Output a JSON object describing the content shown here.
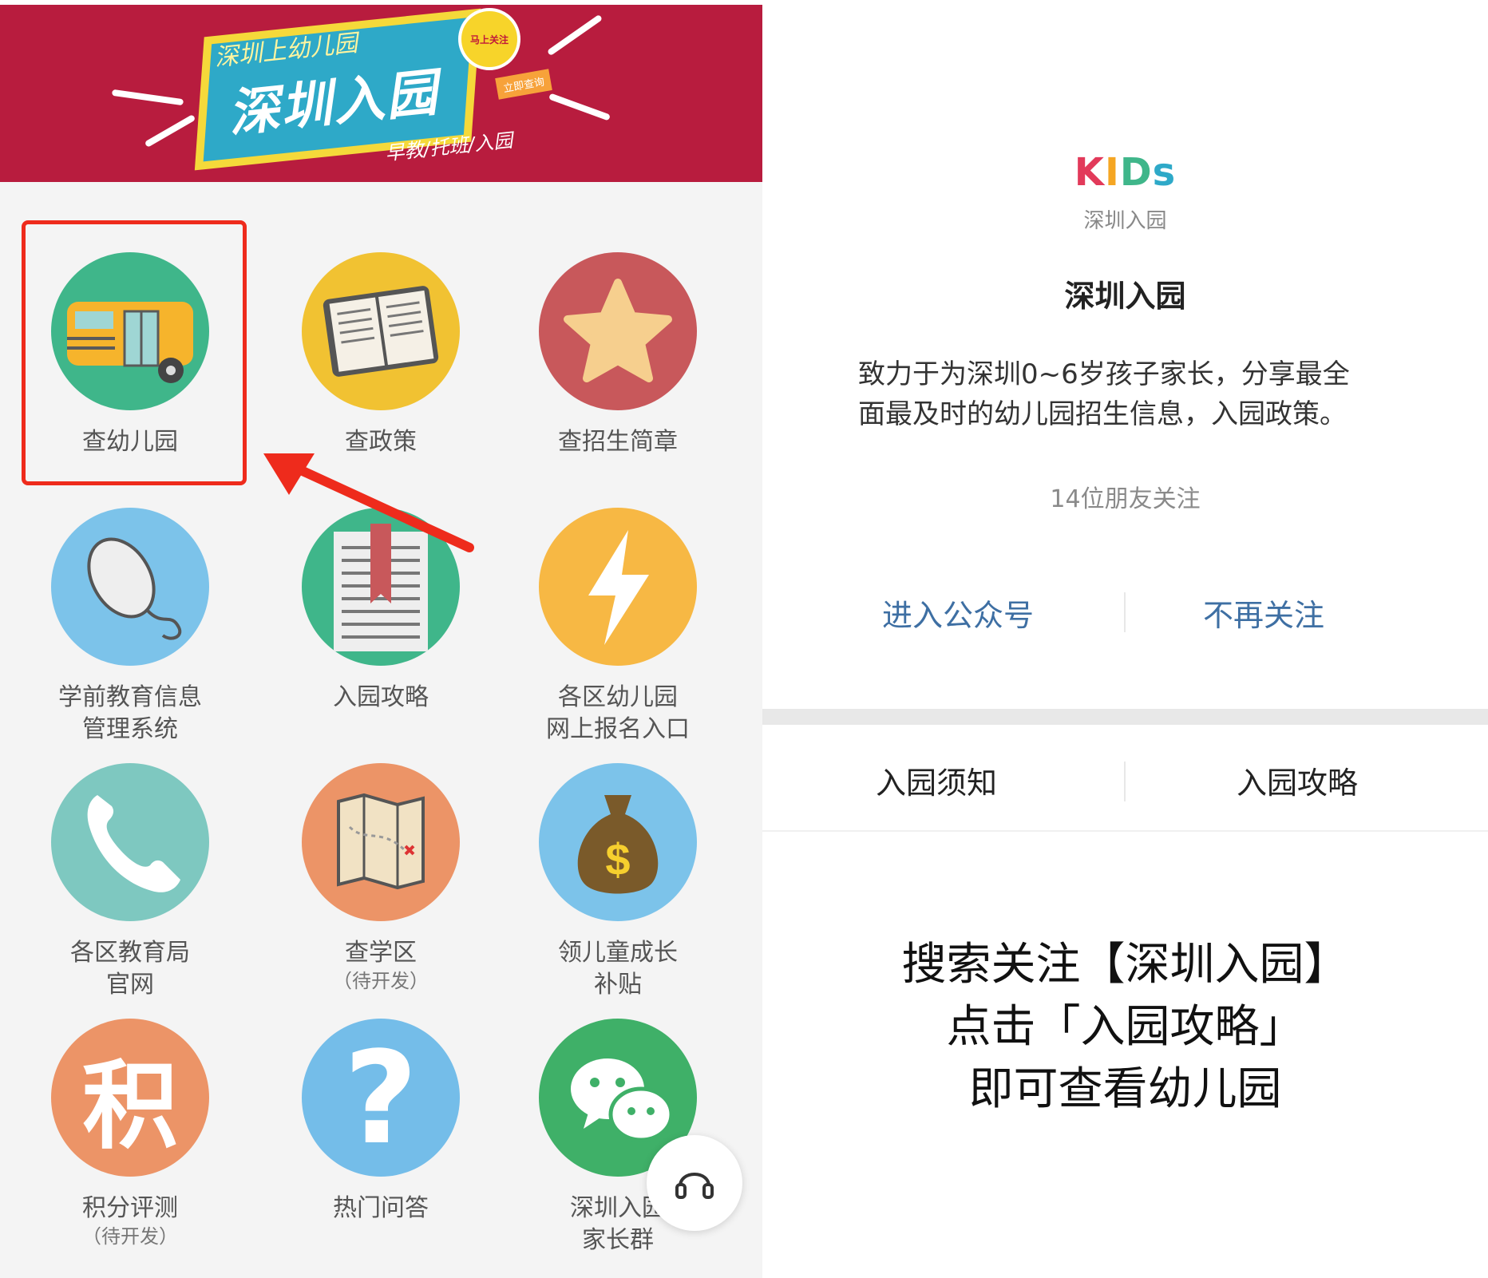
{
  "banner": {
    "line1": "深圳上幼儿园",
    "main_title": "深圳入园",
    "line3": "早教/托班/入园",
    "badge": "马上关注",
    "tag": "立即查询"
  },
  "grid": [
    {
      "label": "查幼儿园",
      "sub": "",
      "icon": "school-bus-icon",
      "color": "#3fb68a"
    },
    {
      "label": "查政策",
      "sub": "",
      "icon": "open-book-icon",
      "color": "#f1c232"
    },
    {
      "label": "查招生简章",
      "sub": "",
      "icon": "star-icon",
      "color": "#c8585b"
    },
    {
      "label": "学前教育信息",
      "sub": "管理系统",
      "icon": "computer-mouse-icon",
      "color": "#7cc3ea"
    },
    {
      "label": "入园攻略",
      "sub": "",
      "icon": "bookmark-book-icon",
      "color": "#3fb68a"
    },
    {
      "label": "各区幼儿园",
      "sub": "网上报名入口",
      "icon": "lightning-icon",
      "color": "#f7b844"
    },
    {
      "label": "各区教育局",
      "sub": "官网",
      "icon": "phone-icon",
      "color": "#7ec8c0"
    },
    {
      "label": "查学区",
      "sub": "（待开发）",
      "icon": "map-icon",
      "color": "#ec9467"
    },
    {
      "label": "领儿童成长",
      "sub": "补贴",
      "icon": "money-bag-icon",
      "color": "#7cc3ea"
    },
    {
      "label": "积分评测",
      "sub": "（待开发）",
      "icon": "points-icon",
      "color": "#ec9467"
    },
    {
      "label": "热门问答",
      "sub": "",
      "icon": "question-icon",
      "color": "#74bde9"
    },
    {
      "label": "深圳入园",
      "sub": "家长群",
      "icon": "wechat-icon",
      "color": "#3fb068"
    }
  ],
  "points_glyph": "积",
  "question_glyph": "?",
  "profile": {
    "logo_text": "KIDs",
    "logo_sub": "深圳入园",
    "name": "深圳入园",
    "description_line1": "致力于为深圳0~6岁孩子家长，分享最全",
    "description_line2": "面最及时的幼儿园招生信息，入园政策。",
    "followers": "14位朋友关注",
    "enter_label": "进入公众号",
    "unfollow_label": "不再关注",
    "menu_left": "入园须知",
    "menu_right": "入园攻略"
  },
  "caption": {
    "line1": "搜索关注【深圳入园】",
    "line2": "点击「入园攻略」",
    "line3": "即可查看幼儿园"
  },
  "colors": {
    "banner_bg": "#b81c3e",
    "highlight": "#ee2b1c",
    "link": "#3e6fa3"
  }
}
